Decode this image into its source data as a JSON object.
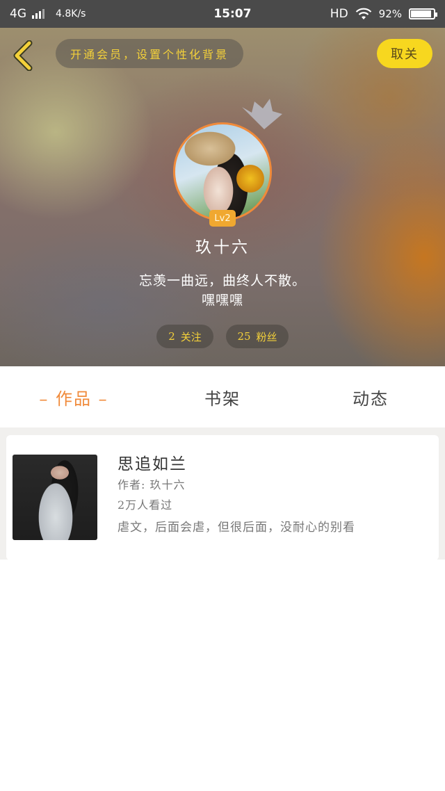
{
  "status_bar": {
    "network": "4G",
    "speed": "4.8K/s",
    "time": "15:07",
    "hd": "HD",
    "battery": "92%",
    "battery_level": 0.92
  },
  "header": {
    "vip_banner": "开通会员，设置个性化背景",
    "unfollow_label": "取关",
    "level": "Lv2",
    "username": "玖十六",
    "bio_line1": "忘羡一曲远，曲终人不散。",
    "bio_line2": "嘿嘿嘿",
    "following_count": "2",
    "following_label": "关注",
    "followers_count": "25",
    "followers_label": "粉丝"
  },
  "tabs": [
    {
      "label": "– 作品 –",
      "active": true
    },
    {
      "label": "书架",
      "active": false
    },
    {
      "label": "动态",
      "active": false
    }
  ],
  "works": [
    {
      "title": "思追如兰",
      "author": "作者: 玖十六",
      "views": "2万人看过",
      "description": "虐文，后面会虐，但很后面，没耐心的别看"
    }
  ],
  "colors": {
    "accent_orange": "#f08a3a",
    "accent_yellow": "#f7d71f",
    "banner_text": "#f4d13a"
  }
}
